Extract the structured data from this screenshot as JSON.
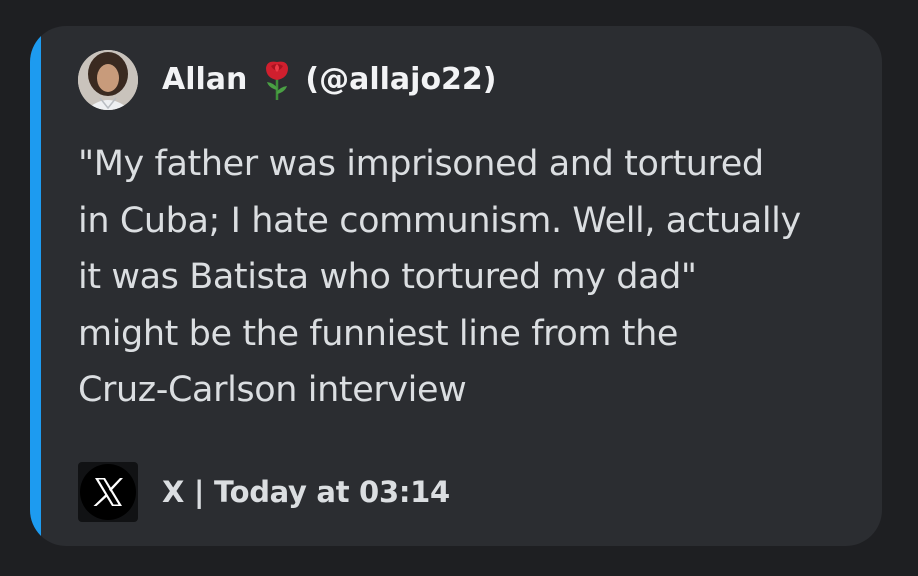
{
  "embed": {
    "accent_color": "#1d9bf0",
    "author": {
      "name": "Allan",
      "emoji_icon": "rose-icon",
      "handle": "(@allajo22)",
      "avatar_icon": "avatar"
    },
    "description": "\"My father was imprisoned and tortured\nin Cuba; I hate communism. Well, actually\nit was Batista who tortured my dad\"\nmight be the funniest line from the\nCruz-Carlson interview",
    "footer": {
      "icon": "x-logo-icon",
      "text": "X | Today at 03:14"
    }
  }
}
